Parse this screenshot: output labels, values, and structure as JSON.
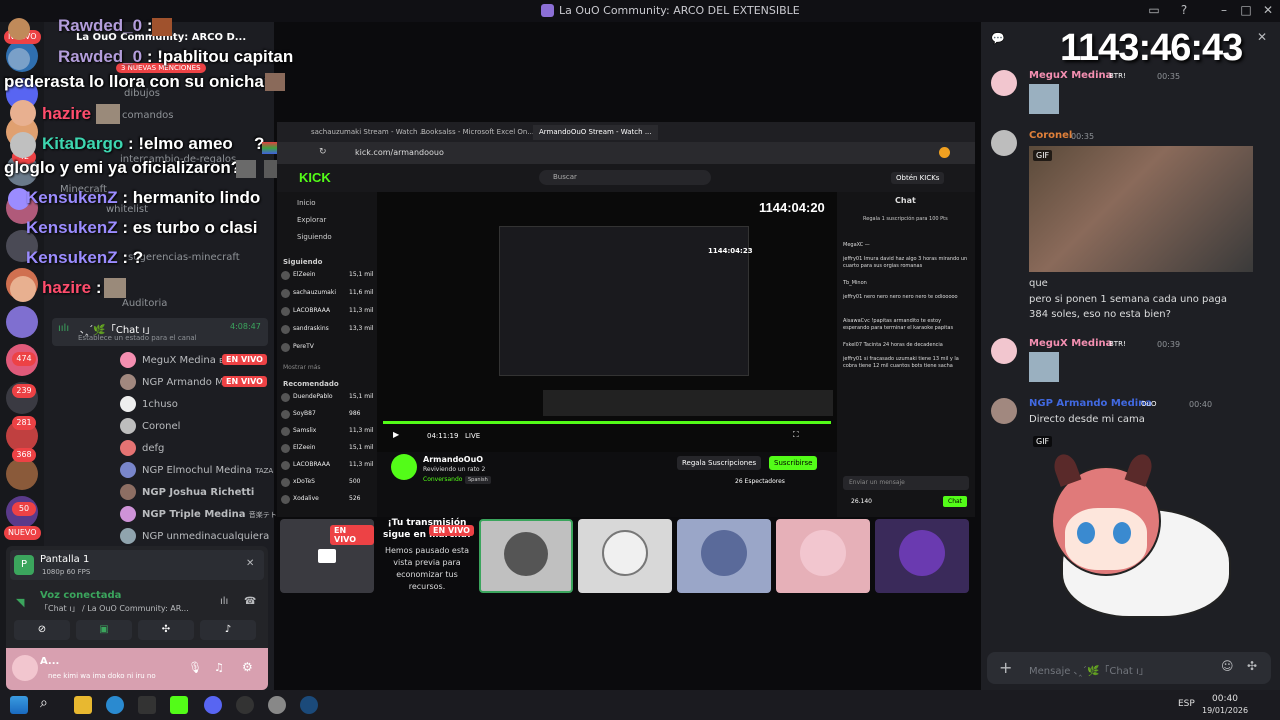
{
  "window": {
    "title": "La OuO Community: ARCO DEL EXTENSIBLE"
  },
  "overlay_chat": [
    {
      "name": "Rawded_0",
      "sep": " :",
      "text": "",
      "color": "#b39ddb"
    },
    {
      "name": "Rawded_0",
      "sep": " : ",
      "text": "!pablitou capitan",
      "color": "#b39ddb"
    },
    {
      "name": "",
      "sep": "",
      "text": "pederasta lo llora con su onichan",
      "color": "#ffffff"
    },
    {
      "name": "hazire",
      "sep": " ",
      "text": "",
      "color": "#ff4d6d"
    },
    {
      "name": "KitaDargo",
      "sep": " : ",
      "text": "!elmo ameo",
      "color": "#3dd6b0"
    },
    {
      "name": "",
      "sep": "",
      "text": "gloglo y emi ya oficializaron?",
      "color": "#ffffff"
    },
    {
      "name": "KensukenZ",
      "sep": " : ",
      "text": "hermanito lindo",
      "color": "#9b8cff"
    },
    {
      "name": "KensukenZ",
      "sep": " : ",
      "text": "es turbo o clasi",
      "color": "#9b8cff"
    },
    {
      "name": "KensukenZ",
      "sep": " : ",
      "text": "?",
      "color": "#9b8cff"
    },
    {
      "name": "hazire",
      "sep": " : ",
      "text": "",
      "color": "#ff4d6d"
    }
  ],
  "overlay_extra": {
    "q": "q",
    "question": "?"
  },
  "server_badges": [
    "NUEVO",
    "42",
    "474",
    "239",
    "281",
    "368",
    "50",
    "NUEVO"
  ],
  "server_header": {
    "name": "La OuO Community: ARCO D...",
    "mentions": "3 NUEVAS MENCIONES"
  },
  "channels": [
    "dibujos",
    "comandos",
    "intercambio-de-regalos",
    "Minecraft",
    "whitelist",
    "sugerencias-minecraft",
    "Auditoria"
  ],
  "voice_channel": {
    "name": "､‸´🌿「Chat ı」",
    "timer": "4:08:47",
    "status": "Establece un estado para el canal"
  },
  "voice_users": [
    {
      "name": "MeguX Medina",
      "tag": "BTR!",
      "live": "EN VIVO",
      "color": "#f48fb1"
    },
    {
      "name": "NGP Armando Medina",
      "tag": "",
      "live": "EN VIVO",
      "color": "#a1887f"
    },
    {
      "name": "1chuso",
      "tag": "",
      "live": "",
      "color": "#ffffff"
    },
    {
      "name": "Coronel",
      "tag": "",
      "live": "",
      "color": "#bdbdbd"
    },
    {
      "name": "defg",
      "tag": "",
      "live": "",
      "color": "#e57373"
    },
    {
      "name": "NGP Elmochul Medina",
      "tag": "TAZA",
      "live": "",
      "color": "#7986cb"
    },
    {
      "name": "NGP Joshua Richetti",
      "tag": "",
      "live": "",
      "color": "#8d6e63"
    },
    {
      "name": "NGP Triple Medina",
      "tag": "音楽テト",
      "live": "",
      "color": "#ce93d8"
    },
    {
      "name": "NGP unmedinacualquiera",
      "tag": "",
      "live": "",
      "color": "#90a4ae"
    }
  ],
  "screen_share": {
    "name": "Pantalla 1",
    "quality": "1080p 60 FPS"
  },
  "voice_status": {
    "title": "Voz conectada",
    "channel": "「Chat ı」 / La OuO Community: AR..."
  },
  "user": {
    "name": "A...",
    "status": "nee kimi wa ima doko ni iru no"
  },
  "preview_tile": {
    "live": "EN VIVO",
    "headline": "¡Tu transmisión sigue en marcha!",
    "body": "Hemos pausado esta vista previa para economizar tus recursos.",
    "live2": "EN VIVO"
  },
  "browser": {
    "tabs": [
      "sachauzumaki Stream - Watch ...",
      "Booksalss - Microsoft Excel On...",
      "ArmandoOuO Stream - Watch ..."
    ],
    "url": "kick.com/armandoouo",
    "search": "Buscar",
    "get_kicks": "Obtén KICKs",
    "nav": [
      "Inicio",
      "Explorar",
      "Siguiendo"
    ],
    "following_title": "Siguiendo",
    "following": [
      {
        "name": "ElZeein",
        "count": "15,1 mil"
      },
      {
        "name": "sachauzumaki",
        "count": "11,6 mil"
      },
      {
        "name": "LACOBRAAA",
        "count": "11,3 mil"
      },
      {
        "name": "sandraskins",
        "count": "13,3 mil"
      },
      {
        "name": "PereTV",
        "count": ""
      }
    ],
    "show_more": "Mostrar más",
    "recommended_title": "Recomendado",
    "recommended": [
      {
        "name": "DuendePablo",
        "count": "15,1 mil"
      },
      {
        "name": "SoyB87",
        "count": "986"
      },
      {
        "name": "Samslix",
        "count": "11,3 mil"
      },
      {
        "name": "ElZeein",
        "count": "15,1 mil"
      },
      {
        "name": "LACOBRAAA",
        "count": "11,3 mil"
      },
      {
        "name": "xDoTeS",
        "count": "500"
      },
      {
        "name": "Xodalive",
        "count": "526"
      }
    ],
    "stream_timer": "1144:04:20",
    "time_elapsed": "04:11:19",
    "live_label": "LIVE",
    "channel_name": "ArmandoOuO",
    "channel_sub": "Reviviendo un rato 2",
    "category": "Conversando",
    "language": "Spanish",
    "gift_subs": "Regala Suscripciones",
    "subscribe": "Suscribirse",
    "viewers": "26 Espectadores",
    "chat_title": "Chat",
    "chat_gift": "Regala 1 suscripción para 100 Pts",
    "chat_lines": [
      "MegaXC —",
      "jeffry01 Imura david haz algo 3 horas mirando un cuarto para sus orgias romanas",
      "Tb_Minon",
      "jeffry01 nero nero nero nero nero te odiooooo",
      "AisawaCvc !papitas armandito te estoy esperando para terminar el karaoke papitas",
      "Fskel07 Tacinta 24 horas de decadencia",
      "jeffry01 si fracasado uzumaki tiene 13 mil y la cobra tiene 12 mil cuantos bots tiene sacha"
    ],
    "chat_input": "Enviar un mensaje",
    "points": "26.140",
    "chat_btn": "Chat",
    "small_timer": "1144:04:23"
  },
  "right_panel": {
    "timer": "1143:46:43",
    "messages": [
      {
        "name": "MeguX Medina",
        "badge": "BTR!",
        "time": "00:35",
        "color": "#f48fb1",
        "text": ""
      },
      {
        "name": "Coronel",
        "badge": "",
        "time": "00:35",
        "color": "#e0803a",
        "text": ""
      },
      {
        "name": "",
        "badge": "",
        "time": "",
        "color": "",
        "text": "que"
      },
      {
        "name": "",
        "badge": "",
        "time": "",
        "color": "",
        "text": "pero si ponen 1 semana cada uno paga 384 soles, eso no esta bien?"
      },
      {
        "name": "MeguX Medina",
        "badge": "BTR!",
        "time": "00:39",
        "color": "#f48fb1",
        "text": ""
      },
      {
        "name": "NGP Armando Medina",
        "badge": "OuO",
        "time": "00:40",
        "color": "#4169e1",
        "text": "Directo desde mi cama"
      }
    ],
    "gif_label": "GIF",
    "gif_label2": "GIF",
    "input_placeholder": "Mensaje ､‸´🌿「Chat ı」"
  },
  "taskbar": {
    "lang": "ESP",
    "time": "00:40",
    "date": "19/01/2026"
  },
  "colors": {
    "discord_bg": "#1e1f24",
    "kick_green": "#53fc18",
    "live_red": "#ed4245"
  }
}
